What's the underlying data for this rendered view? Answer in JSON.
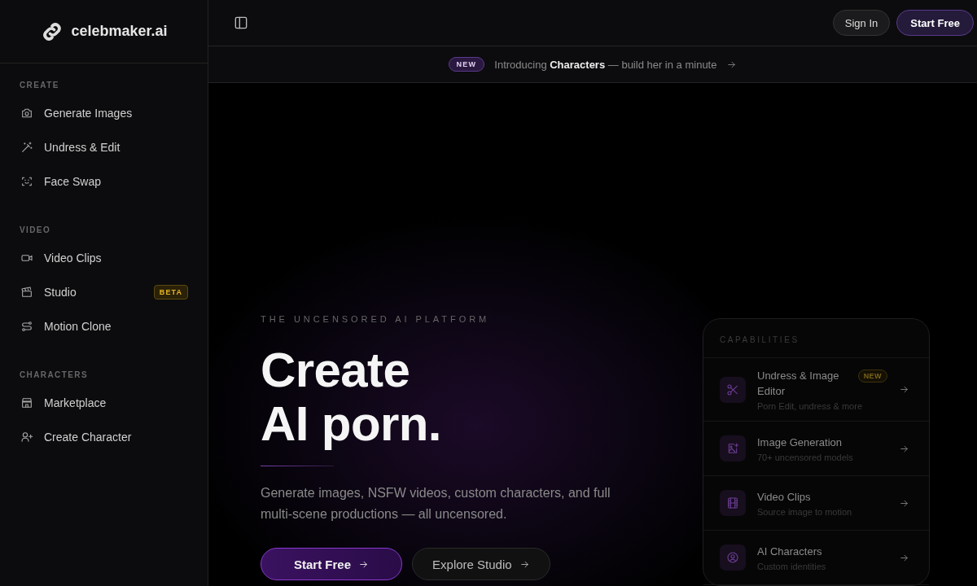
{
  "sidebar": {
    "logo": "celebmaker.ai",
    "sections": [
      {
        "title": "CREATE",
        "items": [
          {
            "label": "Generate Images",
            "selected": false
          },
          {
            "label": "Undress & Edit",
            "selected": false
          },
          {
            "label": "Face Swap",
            "selected": false
          }
        ]
      },
      {
        "title": "VIDEO",
        "items": [
          {
            "label": "Video Clips",
            "selected": false
          },
          {
            "label": "Studio",
            "selected": false,
            "badge": "BETA"
          },
          {
            "label": "Motion Clone",
            "selected": false
          }
        ]
      },
      {
        "title": "CHARACTERS",
        "items": [
          {
            "label": "Marketplace",
            "selected": false
          },
          {
            "label": "Create Character",
            "selected": false
          }
        ]
      }
    ]
  },
  "topbar": {
    "buttons": [
      {
        "label": "Sign In",
        "kind": "secondary"
      },
      {
        "label": "Start Free",
        "kind": "primary"
      }
    ]
  },
  "announcement": {
    "badge": "NEW",
    "text": "Introducing **Characters** — build her in a minute"
  },
  "hero": {
    "eyebrow": "THE UNCENSORED AI PLATFORM",
    "headline": [
      "Create",
      "AI porn."
    ],
    "description": "Generate images, NSFW videos, custom characters, and full multi-scene productions — all uncensored.",
    "buttons": [
      {
        "label": "Start Free",
        "kind": "primary"
      },
      {
        "label": "Explore Studio",
        "kind": "secondary"
      }
    ]
  },
  "capabilities": {
    "title": "CAPABILITIES",
    "items": [
      {
        "title": "Undress & Image Editor",
        "subtitle": "Porn Edit, undress & more",
        "badge": "NEW"
      },
      {
        "title": "Image Generation",
        "subtitle": "70+ uncensored models"
      },
      {
        "title": "Video Clips",
        "subtitle": "Source image to motion"
      },
      {
        "title": "AI Characters",
        "subtitle": "Custom identities"
      }
    ]
  }
}
